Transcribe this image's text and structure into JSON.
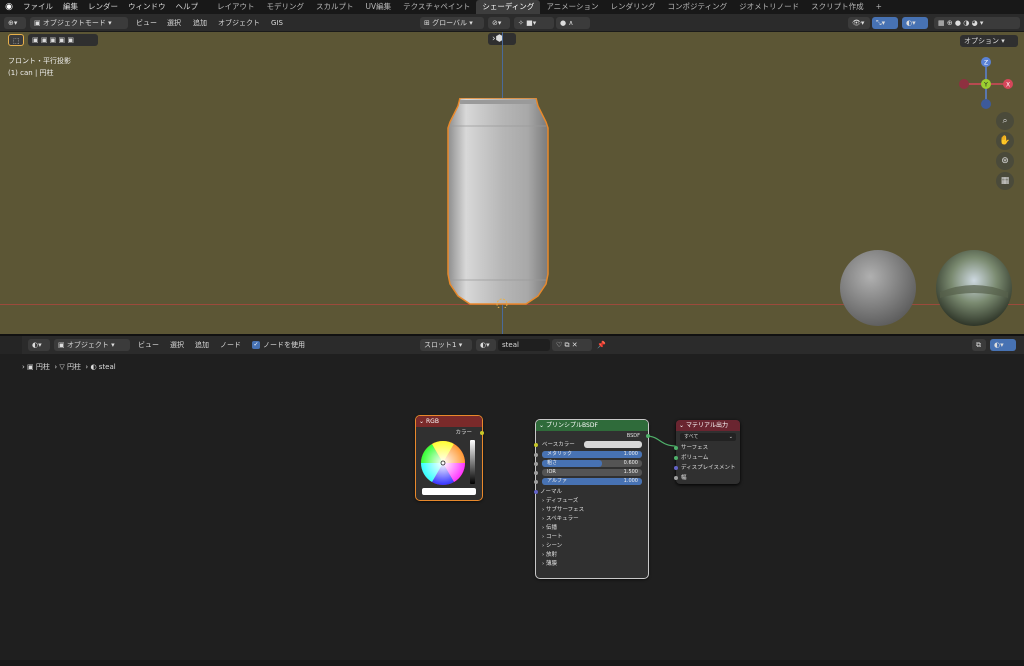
{
  "menu": {
    "items": [
      "ファイル",
      "編集",
      "レンダー",
      "ウィンドウ",
      "ヘルプ"
    ]
  },
  "workspaces": {
    "tabs": [
      "レイアウト",
      "モデリング",
      "スカルプト",
      "UV編集",
      "テクスチャペイント",
      "シェーディング",
      "アニメーション",
      "レンダリング",
      "コンポジティング",
      "ジオメトリノード",
      "スクリプト作成"
    ],
    "active": "シェーディング",
    "add": "+"
  },
  "viewport_header": {
    "mode": "オブジェクトモード",
    "menus": [
      "ビュー",
      "選択",
      "追加",
      "オブジェクト",
      "GIS"
    ],
    "orientation": "グローバル",
    "options": "オプション"
  },
  "viewport": {
    "view_name": "フロント・平行投影",
    "object_info": "(1) can | 円柱",
    "gizmo": {
      "z": "Z",
      "y": "Y",
      "x": "X"
    }
  },
  "node_header": {
    "type": "オブジェクト",
    "menus": [
      "ビュー",
      "選択",
      "追加",
      "ノード"
    ],
    "use_nodes": "ノードを使用",
    "slot": "スロット1",
    "material": "steal"
  },
  "breadcrumb": {
    "object": "円柱",
    "mesh": "円柱",
    "material": "steal"
  },
  "nodes": {
    "rgb": {
      "title": "RGB",
      "output": "カラー"
    },
    "bsdf": {
      "title": "プリンシプルBSDF",
      "output": "BSDF",
      "base_color": "ベースカラー",
      "metallic": {
        "label": "メタリック",
        "value": "1.000",
        "fraction": 1.0
      },
      "roughness": {
        "label": "粗さ",
        "value": "0.600",
        "fraction": 0.6
      },
      "ior": {
        "label": "IOR",
        "value": "1.500",
        "fraction": 0
      },
      "alpha": {
        "label": "アルファ",
        "value": "1.000",
        "fraction": 1.0
      },
      "normal": "ノーマル",
      "panels": [
        "ディフューズ",
        "サブサーフェス",
        "スペキュラー",
        "伝播",
        "コート",
        "シーン",
        "放射",
        "薄膜"
      ]
    },
    "output": {
      "title": "マテリアル出力",
      "target": "すべて",
      "inputs": [
        "サーフェス",
        "ボリューム",
        "ディスプレイスメント",
        "幅"
      ]
    }
  },
  "colors": {
    "viewport_bg": "#5c5635",
    "rgb_header": "#7a2a2a",
    "bsdf_header": "#2f6b3a",
    "output_header": "#6a2530",
    "selected_outline": "#e8892c",
    "field_blue": "#4772b3"
  }
}
